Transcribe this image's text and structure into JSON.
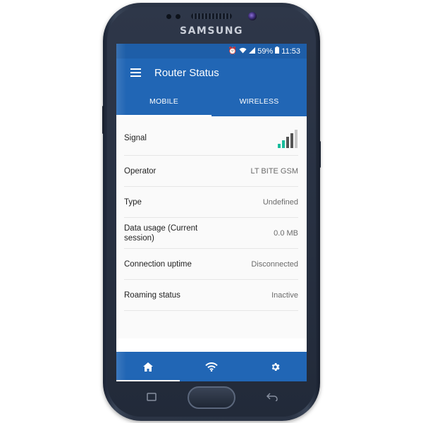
{
  "device": {
    "brand": "SAMSUNG"
  },
  "statusbar": {
    "battery": "59%",
    "time": "11:53",
    "icons": [
      "alarm-icon",
      "wifi-icon",
      "cell-signal-icon",
      "battery-icon"
    ]
  },
  "appbar": {
    "title": "Router Status",
    "menu_icon": "hamburger-menu-icon"
  },
  "tabs": [
    {
      "label": "MOBILE",
      "active": true
    },
    {
      "label": "WIRELESS",
      "active": false
    }
  ],
  "rows": [
    {
      "label": "Signal",
      "value": "",
      "signal_level": 0.8
    },
    {
      "label": "Operator",
      "value": "LT BITE GSM"
    },
    {
      "label": "Type",
      "value": "Undefined"
    },
    {
      "label": "Data usage (Current session)",
      "value": "0.0 MB"
    },
    {
      "label": "Connection uptime",
      "value": "Disconnected"
    },
    {
      "label": "Roaming status",
      "value": "Inactive"
    }
  ],
  "bottom_nav": [
    {
      "icon": "home-icon",
      "active": true
    },
    {
      "icon": "wifi-icon",
      "active": false
    },
    {
      "icon": "gear-icon",
      "active": false
    }
  ],
  "colors": {
    "primary": "#2166b5",
    "statusbar": "#1e5ea8",
    "signal_active": "#1abc9c",
    "signal_inactive": "#555555"
  }
}
